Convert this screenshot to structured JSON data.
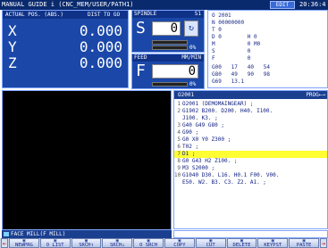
{
  "title_bar": {
    "title": "MANUAL GUIDE i (CNC_MEM/USER/PATH1)",
    "mode": "EDIT",
    "time": "20:36:4"
  },
  "position": {
    "header_left": "ACTUAL POS. (ABS.)",
    "header_right": "DIST TO GO",
    "axes": [
      {
        "axis": "X",
        "value": "0.000"
      },
      {
        "axis": "Y",
        "value": "0.000"
      },
      {
        "axis": "Z",
        "value": "0.000"
      }
    ]
  },
  "spindle": {
    "header": "SPINDLE",
    "channel": "S1",
    "letter": "S",
    "value": "0",
    "load_percent": "0%",
    "load_fraction": 0.0
  },
  "feed": {
    "header": "FEED",
    "unit": "MM/MIN",
    "letter": "F",
    "value": "0",
    "override_percent": "0%",
    "override_fraction": 0.0
  },
  "modal": {
    "lines": [
      "O 2001",
      "N 00000000",
      "T 0",
      "D 0        H 0",
      "M          0 M0",
      "S          0",
      "F          0",
      "G00   17   40   54",
      "G80   49   90   98",
      "G69   13.1"
    ]
  },
  "viewer": {
    "label": "FACE MILL(F MILL)"
  },
  "program": {
    "header": "O2001",
    "header_right": "PROG←→",
    "current_line": 7,
    "lines": [
      {
        "n": "1",
        "text": "O2001 (DEMOMAINGEAR) ;"
      },
      {
        "n": "2",
        "text": "G1902 B200. D200. H40. I100."
      },
      {
        "n": "",
        "text": "J100. K3. ;"
      },
      {
        "n": "3",
        "text": "G40 G49 G80 ;"
      },
      {
        "n": "4",
        "text": "G90 ;"
      },
      {
        "n": "5",
        "text": "G0 X0 Y0 Z300 ;"
      },
      {
        "n": "6",
        "text": "T02 ;"
      },
      {
        "n": "7",
        "text": "D1 ;"
      },
      {
        "n": "8",
        "text": "G0 G43 H2 Z100. ;"
      },
      {
        "n": "9",
        "text": "M3 S2000 ;"
      },
      {
        "n": "10",
        "text": "G1040 D30. L16. H0.1 F00. V00."
      },
      {
        "n": "",
        "text": "E50. W2. B3. C3. Z2. A1. ;"
      }
    ]
  },
  "softkeys": [
    {
      "label": "NEWPRG",
      "icon": "new-program-icon"
    },
    {
      "label": "O LIST",
      "icon": "program-list-icon"
    },
    {
      "label": "SRCH↑",
      "icon": "search-up-icon"
    },
    {
      "label": "SRCH↓",
      "icon": "search-down-icon"
    },
    {
      "label": "O SRCH",
      "icon": "o-search-icon"
    },
    {
      "label": "COPY",
      "icon": "copy-icon"
    },
    {
      "label": "CUT",
      "icon": "cut-icon"
    },
    {
      "label": "DELETE",
      "icon": "delete-icon"
    },
    {
      "label": "KEYPST",
      "icon": "key-paste-icon"
    },
    {
      "label": "PASTE",
      "icon": "paste-icon"
    }
  ],
  "colors": {
    "panel_blue": "#1b48a8",
    "highlight": "#ffff33"
  }
}
